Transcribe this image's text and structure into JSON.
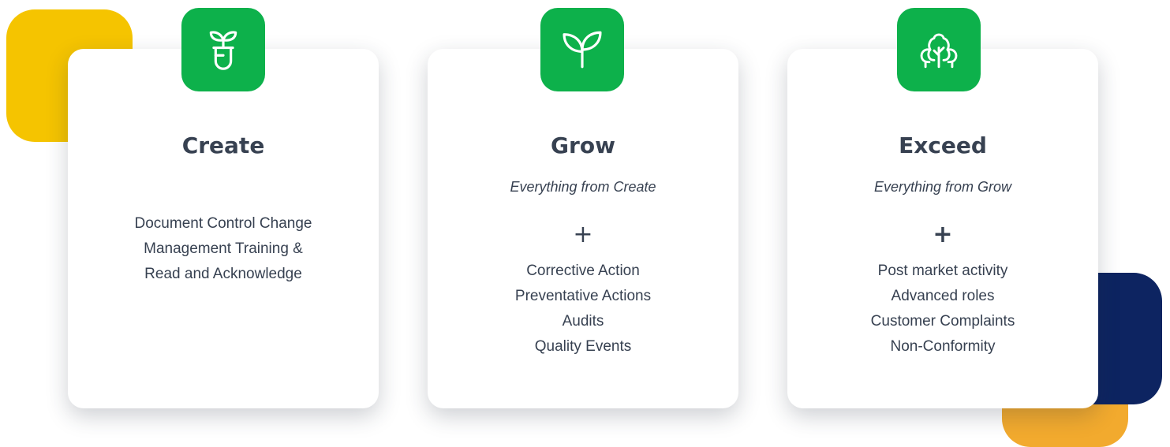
{
  "colors": {
    "accent_green": "#0db14b",
    "decor_yellow": "#f5c400",
    "decor_navy": "#0d2461",
    "decor_orange": "#f2aa2e",
    "text_dark": "#374151"
  },
  "plans": [
    {
      "icon": "seedling-tube-icon",
      "title": "Create",
      "features_text": "Document Control Change Management Training & Read and Acknowledge"
    },
    {
      "icon": "sprout-icon",
      "title": "Grow",
      "subtitle": "Everything from Create",
      "plus": "+",
      "features": [
        "Corrective Action",
        "Preventative Actions",
        "Audits",
        "Quality Events"
      ]
    },
    {
      "icon": "trees-icon",
      "title": "Exceed",
      "subtitle": "Everything from Grow",
      "plus": "+",
      "features": [
        "Post market activity",
        "Advanced roles",
        "Customer Complaints",
        "Non-Conformity"
      ]
    }
  ]
}
